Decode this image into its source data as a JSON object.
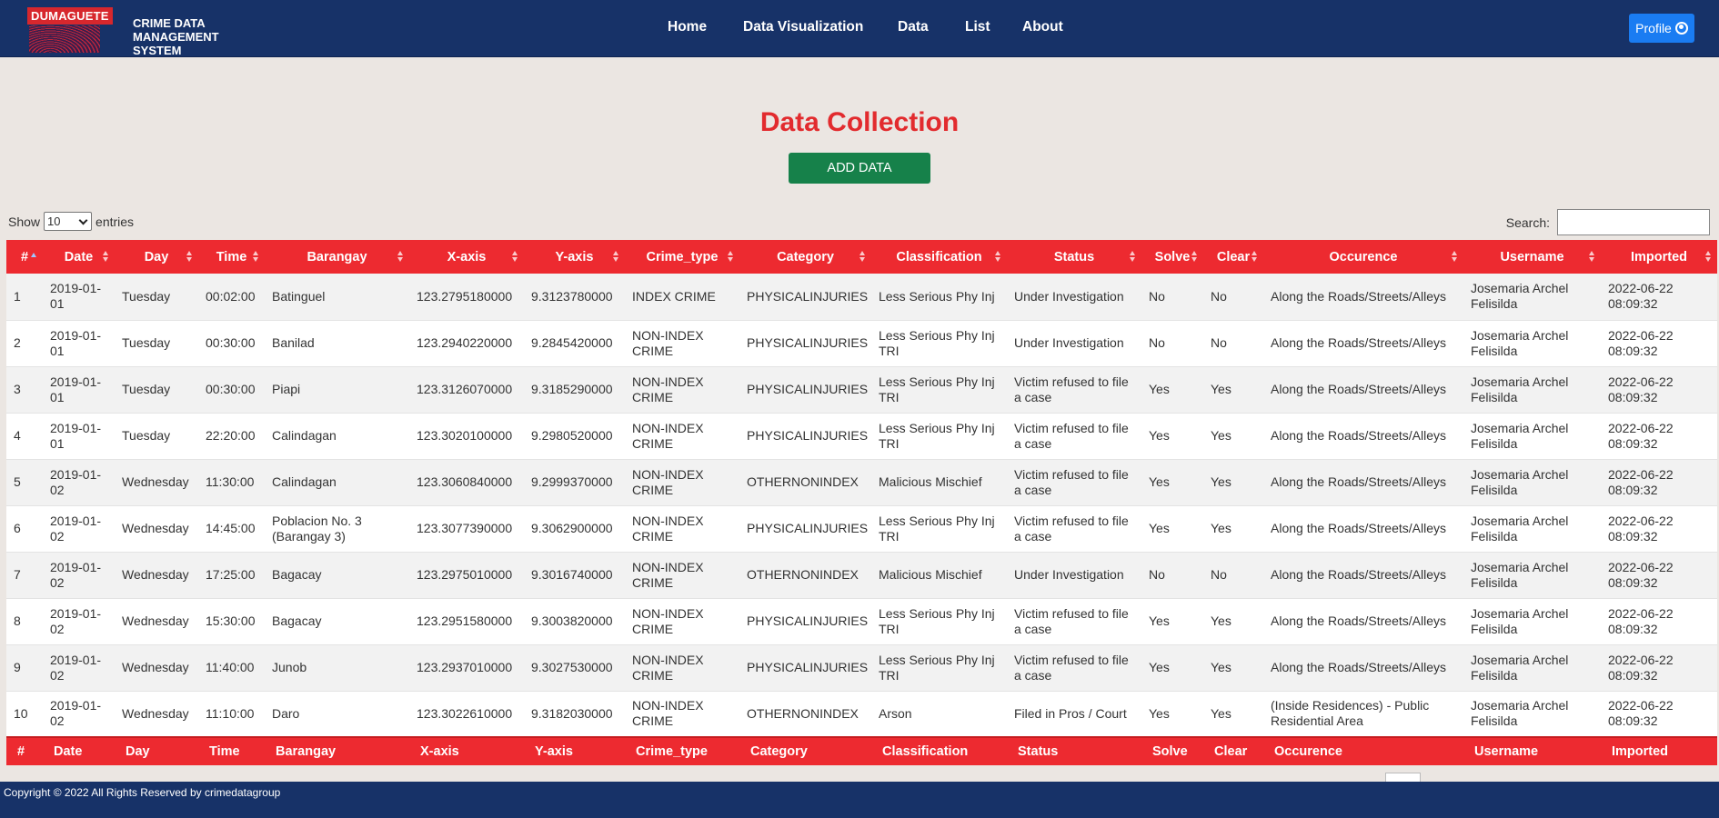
{
  "brand": {
    "tag": "DUMAGUETE",
    "title_lines": [
      "CRIME DATA",
      "MANAGEMENT",
      "SYSTEM"
    ]
  },
  "nav": [
    "Home",
    "Data Visualization",
    "Data",
    "List",
    "About"
  ],
  "profile": {
    "label": "Profile",
    "icon": "user-circle-icon"
  },
  "page": {
    "title": "Data Collection",
    "add_button": "ADD DATA"
  },
  "controls": {
    "show_label": "Show",
    "entries_value": "10",
    "entries_label": "entries",
    "search_label": "Search:"
  },
  "colors": {
    "navbar": "#173268",
    "header": "#ed2a30",
    "title": "#e22b2e",
    "add_button": "#16814a",
    "profile_button": "#1a7cf2"
  },
  "table": {
    "columns": [
      "#",
      "Date",
      "Day",
      "Time",
      "Barangay",
      "X-axis",
      "Y-axis",
      "Crime_type",
      "Category",
      "Classification",
      "Status",
      "Solve",
      "Clear",
      "Occurence",
      "Username",
      "Imported"
    ],
    "rows": [
      [
        "1",
        "2019-01-01",
        "Tuesday",
        "00:02:00",
        "Batinguel",
        "123.2795180000",
        "9.3123780000",
        "INDEX CRIME",
        "PHYSICALINJURIES",
        "Less Serious Phy Inj",
        "Under Investigation",
        "No",
        "No",
        "Along the Roads/Streets/Alleys",
        "Josemaria Archel Felisilda",
        "2022-06-22 08:09:32"
      ],
      [
        "2",
        "2019-01-01",
        "Tuesday",
        "00:30:00",
        "Banilad",
        "123.2940220000",
        "9.2845420000",
        "NON-INDEX CRIME",
        "PHYSICALINJURIES",
        "Less Serious Phy Inj TRI",
        "Under Investigation",
        "No",
        "No",
        "Along the Roads/Streets/Alleys",
        "Josemaria Archel Felisilda",
        "2022-06-22 08:09:32"
      ],
      [
        "3",
        "2019-01-01",
        "Tuesday",
        "00:30:00",
        "Piapi",
        "123.3126070000",
        "9.3185290000",
        "NON-INDEX CRIME",
        "PHYSICALINJURIES",
        "Less Serious Phy Inj TRI",
        "Victim refused to file a case",
        "Yes",
        "Yes",
        "Along the Roads/Streets/Alleys",
        "Josemaria Archel Felisilda",
        "2022-06-22 08:09:32"
      ],
      [
        "4",
        "2019-01-01",
        "Tuesday",
        "22:20:00",
        "Calindagan",
        "123.3020100000",
        "9.2980520000",
        "NON-INDEX CRIME",
        "PHYSICALINJURIES",
        "Less Serious Phy Inj TRI",
        "Victim refused to file a case",
        "Yes",
        "Yes",
        "Along the Roads/Streets/Alleys",
        "Josemaria Archel Felisilda",
        "2022-06-22 08:09:32"
      ],
      [
        "5",
        "2019-01-02",
        "Wednesday",
        "11:30:00",
        "Calindagan",
        "123.3060840000",
        "9.2999370000",
        "NON-INDEX CRIME",
        "OTHERNONINDEX",
        "Malicious Mischief",
        "Victim refused to file a case",
        "Yes",
        "Yes",
        "Along the Roads/Streets/Alleys",
        "Josemaria Archel Felisilda",
        "2022-06-22 08:09:32"
      ],
      [
        "6",
        "2019-01-02",
        "Wednesday",
        "14:45:00",
        "Poblacion No. 3 (Barangay 3)",
        "123.3077390000",
        "9.3062900000",
        "NON-INDEX CRIME",
        "PHYSICALINJURIES",
        "Less Serious Phy Inj TRI",
        "Victim refused to file a case",
        "Yes",
        "Yes",
        "Along the Roads/Streets/Alleys",
        "Josemaria Archel Felisilda",
        "2022-06-22 08:09:32"
      ],
      [
        "7",
        "2019-01-02",
        "Wednesday",
        "17:25:00",
        "Bagacay",
        "123.2975010000",
        "9.3016740000",
        "NON-INDEX CRIME",
        "OTHERNONINDEX",
        "Malicious Mischief",
        "Under Investigation",
        "No",
        "No",
        "Along the Roads/Streets/Alleys",
        "Josemaria Archel Felisilda",
        "2022-06-22 08:09:32"
      ],
      [
        "8",
        "2019-01-02",
        "Wednesday",
        "15:30:00",
        "Bagacay",
        "123.2951580000",
        "9.3003820000",
        "NON-INDEX CRIME",
        "PHYSICALINJURIES",
        "Less Serious Phy Inj TRI",
        "Victim refused to file a case",
        "Yes",
        "Yes",
        "Along the Roads/Streets/Alleys",
        "Josemaria Archel Felisilda",
        "2022-06-22 08:09:32"
      ],
      [
        "9",
        "2019-01-02",
        "Wednesday",
        "11:40:00",
        "Junob",
        "123.2937010000",
        "9.3027530000",
        "NON-INDEX CRIME",
        "PHYSICALINJURIES",
        "Less Serious Phy Inj TRI",
        "Victim refused to file a case",
        "Yes",
        "Yes",
        "Along the Roads/Streets/Alleys",
        "Josemaria Archel Felisilda",
        "2022-06-22 08:09:32"
      ],
      [
        "10",
        "2019-01-02",
        "Wednesday",
        "11:10:00",
        "Daro",
        "123.3022610000",
        "9.3182030000",
        "NON-INDEX CRIME",
        "OTHERNONINDEX",
        "Arson",
        "Filed in Pros / Court",
        "Yes",
        "Yes",
        "(Inside Residences) - Public Residential Area",
        "Josemaria Archel Felisilda",
        "2022-06-22 08:09:32"
      ]
    ]
  },
  "footer": {
    "copyright": "Copyright © 2022 All Rights Reserved by crimedatagroup"
  }
}
